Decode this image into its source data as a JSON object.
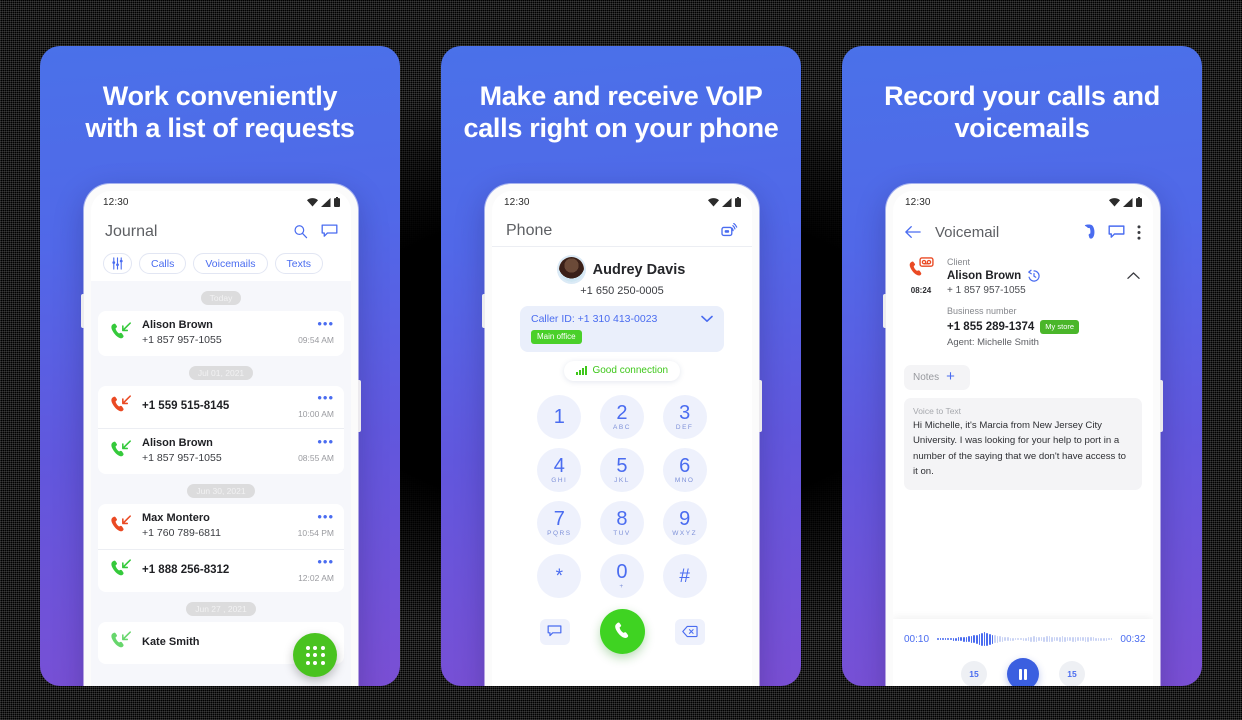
{
  "background": {
    "color": "#000000",
    "grain": true
  },
  "panel_gradient": {
    "top": "#4a71e9",
    "bottom": "#7a4fd4"
  },
  "accent": {
    "blue": "#4a6cf0",
    "green": "#49c31f",
    "red": "#eb4d2a",
    "dark_blue": "#3b5fe0"
  },
  "panels": [
    {
      "id": "journal",
      "title": "Work conveniently\nwith a list of requests",
      "title_line1": "Work conveniently",
      "title_line2": "with a list of requests",
      "status_bar": {
        "time": "12:30",
        "icons": [
          "wifi-icon",
          "signal-icon",
          "battery-icon"
        ]
      },
      "appbar": {
        "title": "Journal",
        "actions": [
          "search-icon",
          "new-message-icon"
        ]
      },
      "chips": [
        "filter-icon",
        "Calls",
        "Voicemails",
        "Texts"
      ],
      "groups": [
        {
          "date": "Today",
          "rows": [
            {
              "direction": "incoming",
              "color": "green",
              "name": "Alison Brown",
              "number": "+1 857 957-1055",
              "time": "09:54 AM",
              "menu": "•••"
            }
          ]
        },
        {
          "date": "Jul 01, 2021",
          "rows": [
            {
              "direction": "missed",
              "color": "red",
              "name": "",
              "number": "+1 559 515-8145",
              "time": "10:00 AM",
              "menu": "•••"
            },
            {
              "direction": "incoming",
              "color": "green",
              "name": "Alison Brown",
              "number": "+1 857 957-1055",
              "time": "08:55 AM",
              "menu": "•••"
            }
          ]
        },
        {
          "date": "Jun 30, 2021",
          "rows": [
            {
              "direction": "missed",
              "color": "red",
              "name": "Max Montero",
              "number": "+1 760 789-6811",
              "time": "10:54 PM",
              "menu": "•••"
            },
            {
              "direction": "incoming",
              "color": "green",
              "name": "",
              "number": "+1 888 256-8312",
              "time": "12:02 AM",
              "menu": "•••"
            }
          ]
        },
        {
          "date": "Jun 27 , 2021",
          "rows": [
            {
              "direction": "incoming",
              "color": "green",
              "name": "Kate Smith",
              "number": "",
              "time": "",
              "menu": "•••"
            }
          ]
        }
      ],
      "fab": "dialpad-fab"
    },
    {
      "id": "phone",
      "title_line1": "Make and receive VoIP",
      "title_line2": "calls right on your phone",
      "status_bar": {
        "time": "12:30",
        "icons": [
          "wifi-icon",
          "signal-icon",
          "battery-icon"
        ]
      },
      "appbar": {
        "title": "Phone",
        "actions": [
          "cast-call-icon"
        ]
      },
      "contact": {
        "name": "Audrey Davis",
        "number": "+1 650 250-0005"
      },
      "caller_id": {
        "text": "Caller ID: +1 310 413-0023",
        "badge": "Main office"
      },
      "connection": {
        "text": "Good connection"
      },
      "keys": [
        {
          "digit": "1",
          "letters": ""
        },
        {
          "digit": "2",
          "letters": "ABC"
        },
        {
          "digit": "3",
          "letters": "DEF"
        },
        {
          "digit": "4",
          "letters": "GHI"
        },
        {
          "digit": "5",
          "letters": "JKL"
        },
        {
          "digit": "6",
          "letters": "MNO"
        },
        {
          "digit": "7",
          "letters": "PQRS"
        },
        {
          "digit": "8",
          "letters": "TUV"
        },
        {
          "digit": "9",
          "letters": "WXYZ"
        },
        {
          "digit": "*",
          "letters": ""
        },
        {
          "digit": "0",
          "letters": "+"
        },
        {
          "digit": "#",
          "letters": ""
        }
      ],
      "actions": [
        "new-message-icon",
        "call-button",
        "backspace-icon"
      ]
    },
    {
      "id": "voicemail",
      "title_line1": "Record your calls and",
      "title_line2": "voicemails",
      "status_bar": {
        "time": "12:30",
        "icons": [
          "wifi-icon",
          "signal-icon",
          "battery-icon"
        ]
      },
      "appbar": {
        "back": "back-arrow-icon",
        "title": "Voicemail",
        "actions": [
          "call-icon",
          "new-message-icon",
          "overflow-menu-icon"
        ]
      },
      "item": {
        "duration": "08:24",
        "client_label": "Client",
        "client_name": "Alison Brown",
        "client_number": "+ 1 857 957-1055",
        "business_label": "Business number",
        "business_number": "+1 855 289-1374",
        "business_badge": "My store",
        "agent": "Agent: Michelle Smith"
      },
      "notes": {
        "label": "Notes",
        "add": "+"
      },
      "voice_to_text": {
        "label": "Voice to Text",
        "text": "Hi Michelle, it's Marcia from New Jersey City University. I was looking for your help to port in a number of the saying that we don't have access to it on."
      },
      "player": {
        "elapsed": "00:10",
        "total": "00:32",
        "rewind": "15",
        "forward": "15",
        "state": "playing"
      }
    }
  ]
}
